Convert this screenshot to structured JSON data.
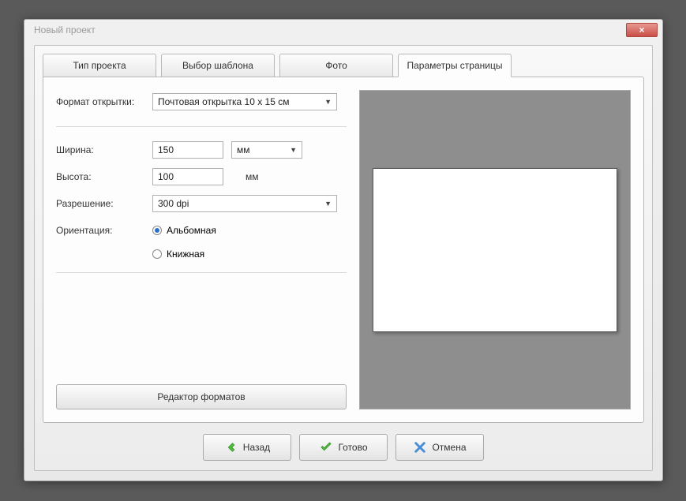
{
  "window": {
    "title": "Новый проект"
  },
  "tabs": {
    "project_type": "Тип проекта",
    "template": "Выбор шаблона",
    "photo": "Фото",
    "page_params": "Параметры страницы"
  },
  "form": {
    "format_label": "Формат открытки:",
    "format_value": "Почтовая открытка 10 х 15 см",
    "width_label": "Ширина:",
    "width_value": "150",
    "width_unit": "мм",
    "height_label": "Высота:",
    "height_value": "100",
    "height_unit": "мм",
    "resolution_label": "Разрешение:",
    "resolution_value": "300 dpi",
    "orientation_label": "Ориентация:",
    "orientation_landscape": "Альбомная",
    "orientation_portrait": "Книжная",
    "format_editor": "Редактор форматов"
  },
  "footer": {
    "back": "Назад",
    "done": "Готово",
    "cancel": "Отмена"
  }
}
